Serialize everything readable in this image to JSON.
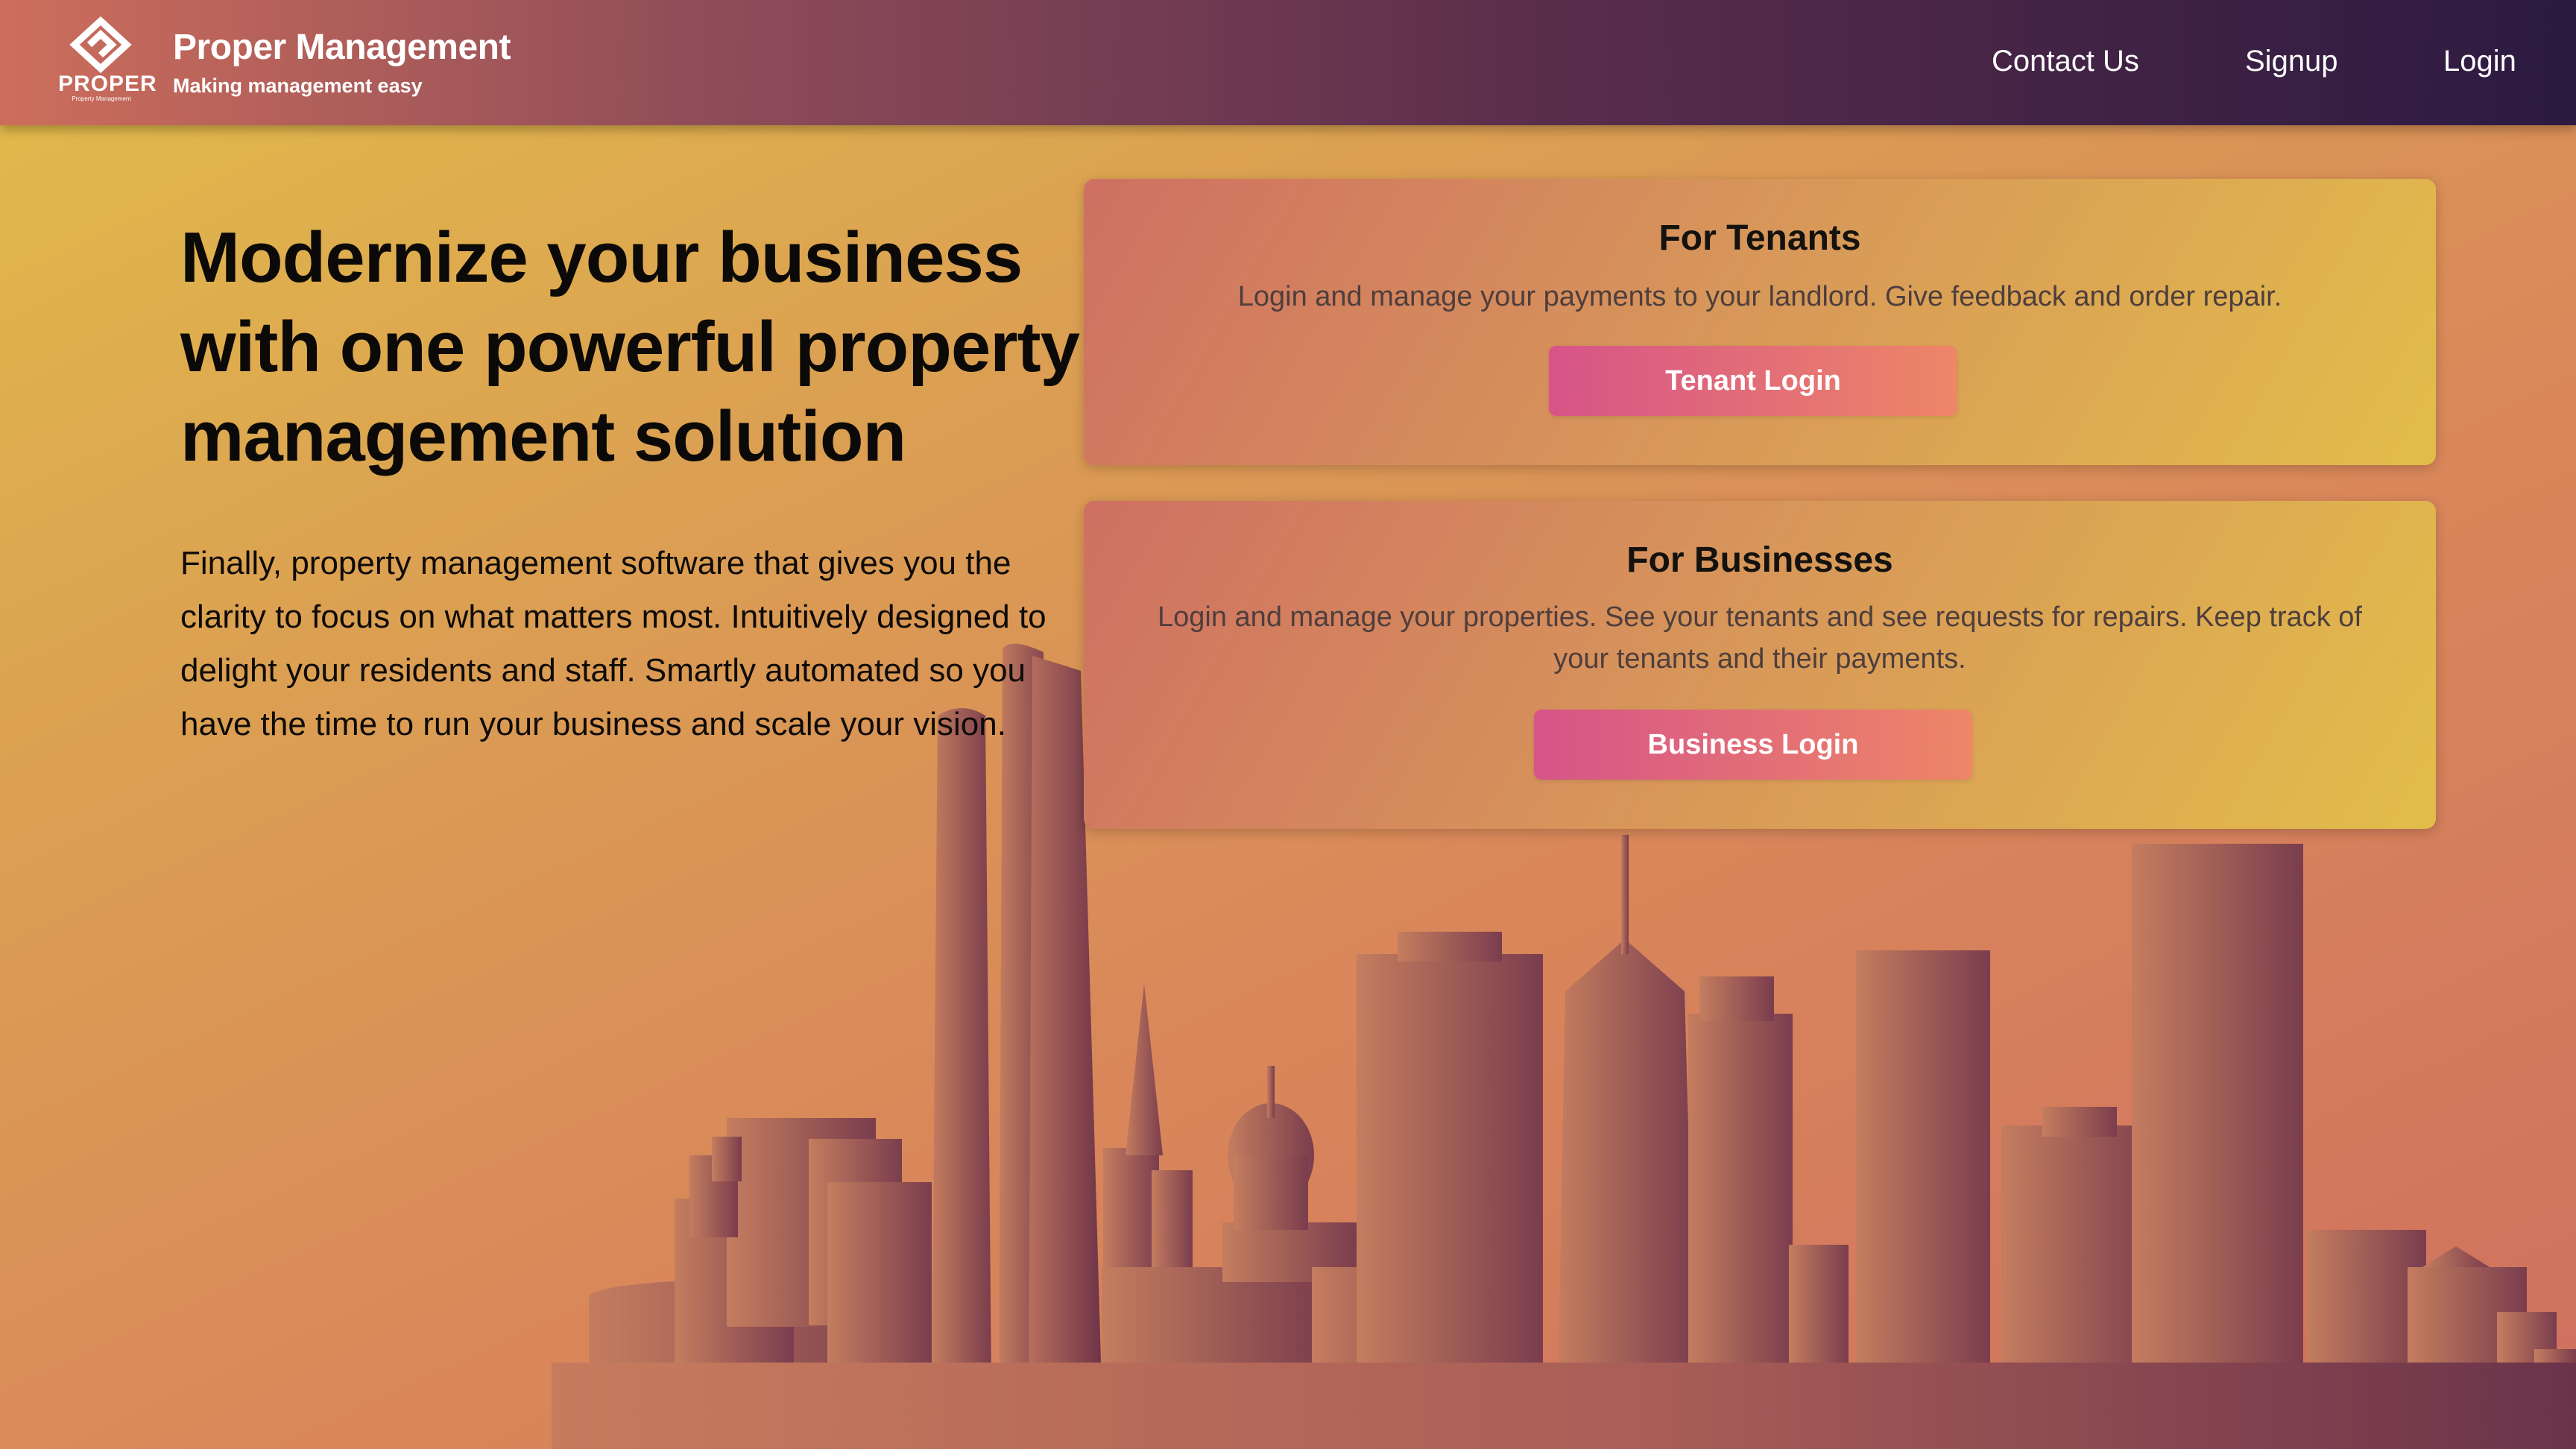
{
  "brand": {
    "logo_word": "PROPER",
    "logo_sub": "Property Management",
    "title": "Proper Management",
    "tagline": "Making management easy"
  },
  "nav": {
    "contact": "Contact Us",
    "signup": "Signup",
    "login": "Login"
  },
  "hero": {
    "heading": "Modernize your business with one powerful property management solution",
    "body": "Finally, property management software that gives you the clarity to focus on what matters most. Intuitively designed to delight your residents and staff. Smartly automated so you have the time to run your business and scale your vision."
  },
  "tenants_card": {
    "title": "For Tenants",
    "description": "Login and manage your payments to your landlord. Give feedback and order repair.",
    "button": "Tenant Login"
  },
  "business_card": {
    "title": "For Businesses",
    "description": "Login and manage your properties. See your tenants and see requests for repairs. Keep track of your tenants and their payments.",
    "button": "Business Login"
  },
  "icons": {
    "logo": "proper-logo-icon",
    "skyline": "city-skyline-illustration"
  },
  "colors": {
    "nav_start": "#cd6e5c",
    "nav_end": "#2c1a41",
    "page_yellow": "#e2bd4a",
    "page_orange": "#d9875a",
    "button_pink": "#d65488",
    "button_orange": "#ee8667",
    "building_light": "#c37a5e",
    "building_dark": "#74394b"
  }
}
